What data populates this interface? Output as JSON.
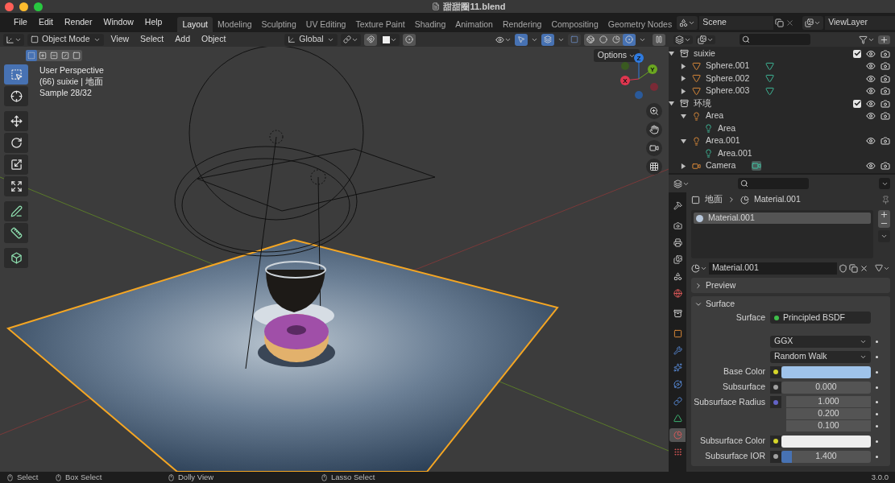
{
  "window": {
    "title": "甜甜圈11.blend"
  },
  "menu": [
    "File",
    "Edit",
    "Render",
    "Window",
    "Help"
  ],
  "workspaces": [
    {
      "label": "Layout",
      "selected": true
    },
    {
      "label": "Modeling",
      "selected": false
    },
    {
      "label": "Sculpting",
      "selected": false
    },
    {
      "label": "UV Editing",
      "selected": false
    },
    {
      "label": "Texture Paint",
      "selected": false
    },
    {
      "label": "Shading",
      "selected": false
    },
    {
      "label": "Animation",
      "selected": false
    },
    {
      "label": "Rendering",
      "selected": false
    },
    {
      "label": "Compositing",
      "selected": false
    },
    {
      "label": "Geometry Nodes",
      "selected": false
    }
  ],
  "scene": {
    "value": "Scene"
  },
  "view_layer": {
    "value": "ViewLayer"
  },
  "viewport": {
    "mode": "Object Mode",
    "menus": [
      "View",
      "Select",
      "Add",
      "Object"
    ],
    "orientation": "Global",
    "options": "Options",
    "select_modes": [
      {
        "kind": "set",
        "selected": true
      },
      {
        "kind": "extend",
        "selected": false
      },
      {
        "kind": "subtract",
        "selected": false
      },
      {
        "kind": "invert",
        "selected": false
      },
      {
        "kind": "intersect",
        "selected": false
      }
    ],
    "shading": [
      {
        "kind": "wireframe",
        "selected": false
      },
      {
        "kind": "solid",
        "selected": false
      },
      {
        "kind": "material",
        "selected": false
      },
      {
        "kind": "rendered",
        "selected": true
      }
    ],
    "info": [
      "User Perspective",
      "(66) suixie | 地面",
      "Sample 28/32"
    ],
    "tools": [
      {
        "kind": "select",
        "selected": true
      },
      {
        "kind": "cursor",
        "selected": false
      },
      {
        "kind": "move",
        "selected": false
      },
      {
        "kind": "rotate",
        "selected": false
      },
      {
        "kind": "scale",
        "selected": false
      },
      {
        "kind": "transform",
        "selected": false
      },
      {
        "kind": "annotate",
        "selected": false
      },
      {
        "kind": "measure",
        "selected": false
      },
      {
        "kind": "add-cube",
        "selected": false
      }
    ],
    "gizmo": [
      {
        "label": "Z",
        "color": "#2f7be0"
      },
      {
        "label": "Y",
        "color": "#6aa620"
      },
      {
        "label": "X",
        "color": "#e0364f"
      }
    ]
  },
  "outliner": {
    "tree": [
      {
        "name": "suixie",
        "kind": "collection",
        "expanded": true,
        "checked": true,
        "children": [
          {
            "name": "Sphere.001",
            "kind": "mesh",
            "expanded": false
          },
          {
            "name": "Sphere.002",
            "kind": "mesh",
            "expanded": false
          },
          {
            "name": "Sphere.003",
            "kind": "mesh",
            "expanded": false
          }
        ]
      },
      {
        "name": "环境",
        "kind": "collection",
        "expanded": true,
        "checked": true,
        "children": [
          {
            "name": "Area",
            "kind": "light",
            "expanded": true,
            "children": [
              {
                "name": "Area",
                "kind": "light-data"
              }
            ]
          },
          {
            "name": "Area.001",
            "kind": "light",
            "expanded": true,
            "children": [
              {
                "name": "Area.001",
                "kind": "light-data"
              }
            ]
          },
          {
            "name": "Camera",
            "kind": "camera",
            "expanded": false
          }
        ]
      }
    ]
  },
  "properties": {
    "tabs": [
      {
        "kind": "tool",
        "selected": false
      },
      {
        "kind": "render",
        "selected": false
      },
      {
        "kind": "output",
        "selected": false
      },
      {
        "kind": "view-layer",
        "selected": false
      },
      {
        "kind": "scene",
        "selected": false
      },
      {
        "kind": "world",
        "selected": false
      },
      {
        "kind": "collection",
        "selected": false
      },
      {
        "kind": "object",
        "selected": false
      },
      {
        "kind": "modifier",
        "selected": false
      },
      {
        "kind": "particles",
        "selected": false
      },
      {
        "kind": "physics",
        "selected": false
      },
      {
        "kind": "constraints",
        "selected": false
      },
      {
        "kind": "data",
        "selected": false
      },
      {
        "kind": "material",
        "selected": true
      },
      {
        "kind": "texture",
        "selected": false
      }
    ],
    "breadcrumb": [
      "地面",
      "Material.001"
    ],
    "slots": [
      {
        "name": "Material.001",
        "selected": true
      }
    ],
    "material": "Material.001",
    "panels": [
      {
        "title": "Preview",
        "expanded": false
      },
      {
        "title": "Surface",
        "expanded": true
      }
    ],
    "surface": {
      "label": "Surface",
      "value": "Principled BSDF",
      "color": "#3fbf4a"
    },
    "rows": [
      {
        "kind": "dropdown",
        "value": "GGX"
      },
      {
        "kind": "dropdown",
        "value": "Random Walk"
      },
      {
        "kind": "color",
        "label": "Base Color",
        "socket": {
          "color": "#d6d62a"
        },
        "color": "#9fc3ea"
      },
      {
        "kind": "number",
        "label": "Subsurface",
        "socket": {
          "color": "#a1a1a1"
        },
        "value": "0.000"
      },
      {
        "kind": "vector",
        "label": "Subsurface Radius",
        "socket": {
          "color": "#6363c7"
        },
        "values": [
          "1.000",
          "0.200",
          "0.100"
        ]
      },
      {
        "kind": "color",
        "label": "Subsurface Color",
        "socket": {
          "color": "#d6d62a"
        },
        "color": "#eeeeee"
      },
      {
        "kind": "slider",
        "label": "Subsurface IOR",
        "socket": {
          "color": "#a1a1a1"
        },
        "value": "1.400",
        "level": 0.12
      }
    ]
  },
  "status_bar": {
    "hints": [
      "Select",
      "Box Select",
      "Dolly View",
      "Lasso Select"
    ],
    "version": "3.0.0"
  }
}
